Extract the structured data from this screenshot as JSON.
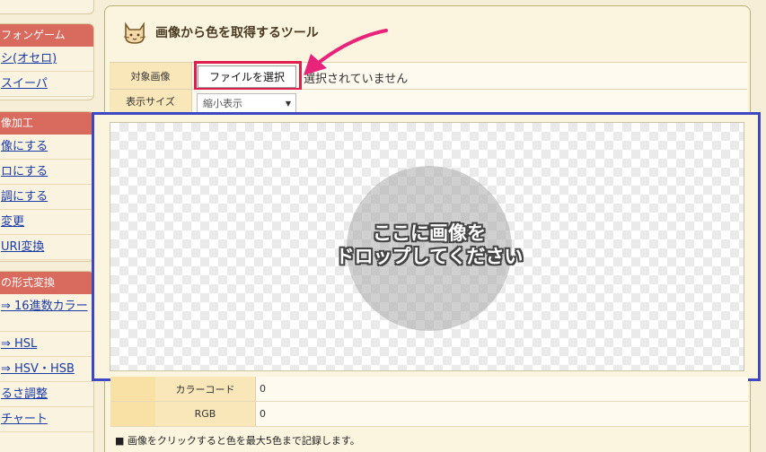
{
  "sidebar": {
    "group1": {
      "heading": "フォンゲーム",
      "items": [
        {
          "label": "シ(オセロ)"
        },
        {
          "label": "スイーパ"
        }
      ]
    },
    "group2": {
      "heading": "像加工",
      "items": [
        {
          "label": "像にする"
        },
        {
          "label": "ロにする"
        },
        {
          "label": "調にする"
        },
        {
          "label": "変更"
        },
        {
          "label": "URI変換"
        }
      ]
    },
    "group3": {
      "heading": "の形式変換",
      "items": [
        {
          "label": "⇒ 16進数カラー"
        },
        {
          "label": "⇒ HSL"
        },
        {
          "label": "⇒ HSV・HSB"
        },
        {
          "label": "るさ調整"
        },
        {
          "label": "チャート"
        }
      ]
    }
  },
  "panel": {
    "title": "画像から色を取得するツール",
    "icon": "cat-face-icon"
  },
  "form": {
    "target_label": "対象画像",
    "file_button_label": "ファイルを選択",
    "file_status": "選択されていません",
    "size_label": "表示サイズ",
    "size_value": "縮小表示"
  },
  "dropzone": {
    "line1": "ここに画像を",
    "line2": "ドロップしてください"
  },
  "results": {
    "rows": [
      {
        "label": "カラーコード",
        "value": "0"
      },
      {
        "label": "RGB",
        "value": "0"
      }
    ]
  },
  "note": "■ 画像をクリックすると色を最大5色まで記録します。",
  "colors": {
    "highlight_box": "#e01e4e",
    "dropzone_border": "#3e47c2",
    "sidebar_heading": "#d86a5e",
    "link": "#1a3aa6"
  }
}
